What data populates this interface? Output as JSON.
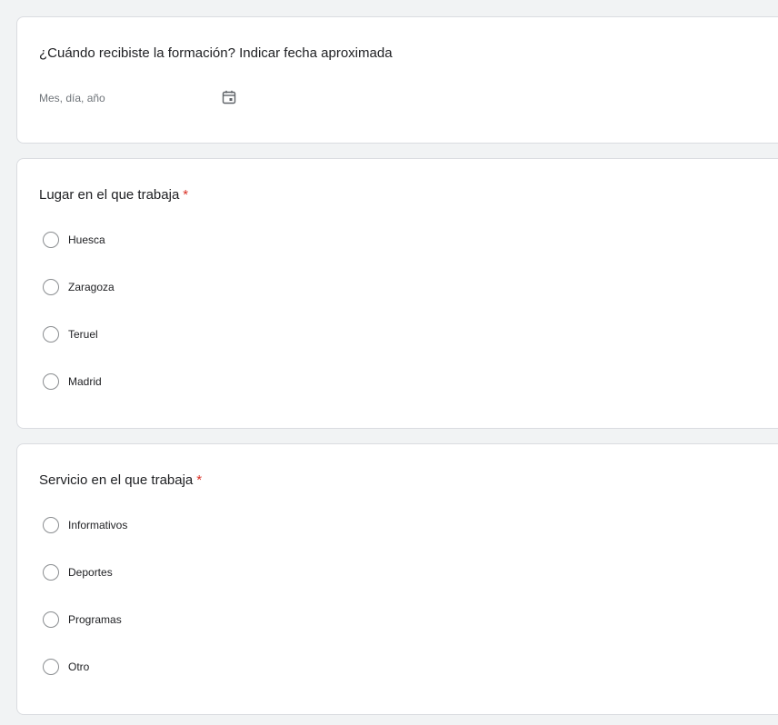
{
  "questions": {
    "date": {
      "title": "¿Cuándo recibiste la formación? Indicar fecha aproximada",
      "placeholder": "Mes, día, año",
      "icon": "calendar-icon"
    },
    "place": {
      "title": "Lugar en el que trabaja",
      "required_mark": "*",
      "options": [
        "Huesca",
        "Zaragoza",
        "Teruel",
        "Madrid"
      ]
    },
    "service": {
      "title": "Servicio en el que trabaja",
      "required_mark": "*",
      "options": [
        "Informativos",
        "Deportes",
        "Programas",
        "Otro"
      ]
    }
  },
  "colors": {
    "background": "#f1f3f4",
    "card": "#ffffff",
    "border": "#dadce0",
    "required": "#d93025",
    "placeholder": "#70757a"
  }
}
